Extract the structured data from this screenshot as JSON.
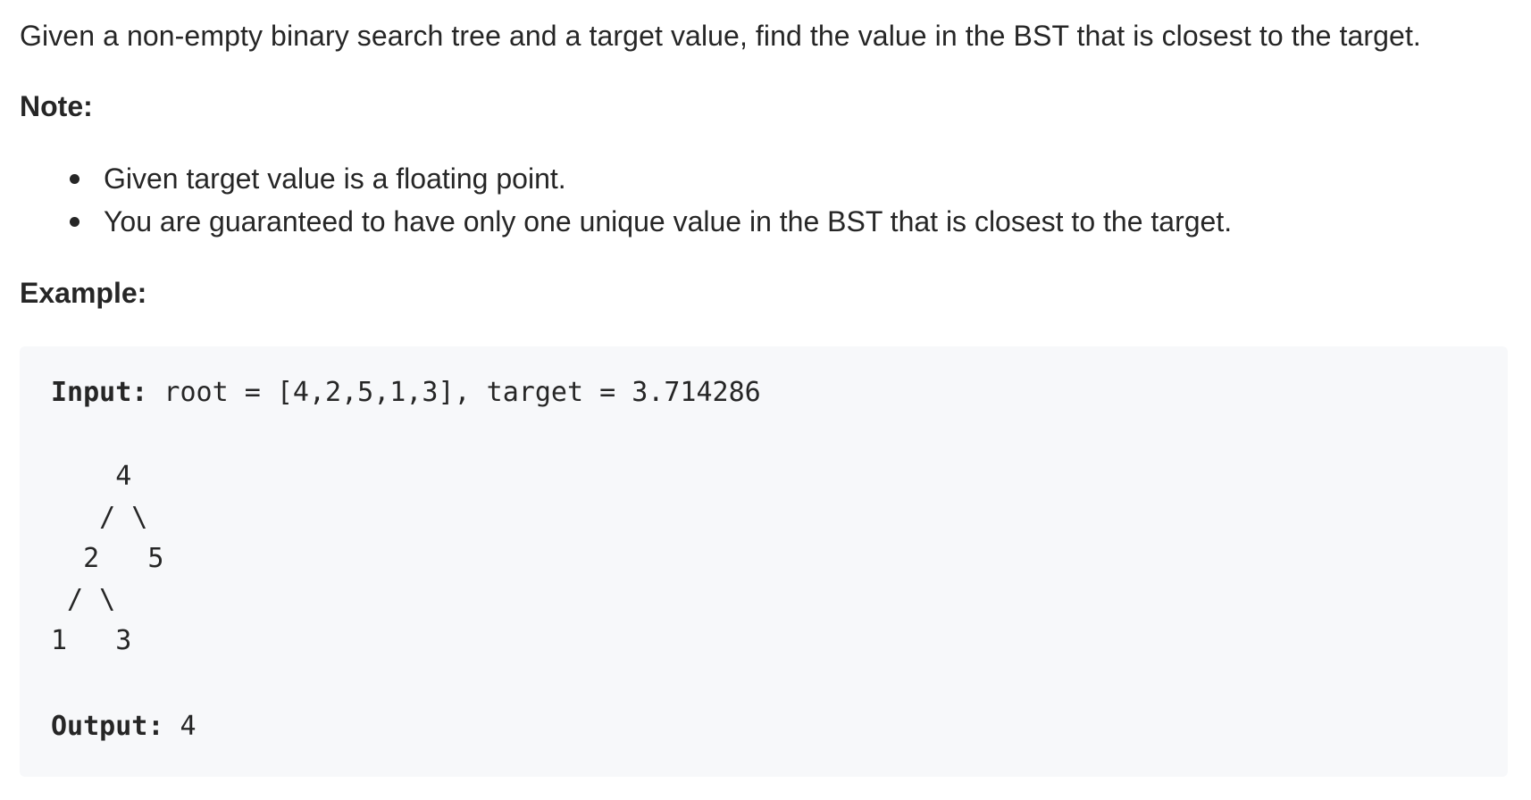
{
  "intro": "Given a non-empty binary search tree and a target value, find the value in the BST that is closest to the target.",
  "note_heading": "Note:",
  "notes": [
    "Given target value is a floating point.",
    "You are guaranteed to have only one unique value in the BST that is closest to the target."
  ],
  "example_heading": "Example:",
  "example": {
    "input_label": "Input:",
    "input_text": " root = [4,2,5,1,3], target = 3.714286",
    "tree_lines": [
      "    4",
      "   / \\",
      "  2   5",
      " / \\",
      "1   3"
    ],
    "output_label": "Output:",
    "output_text": " 4"
  }
}
